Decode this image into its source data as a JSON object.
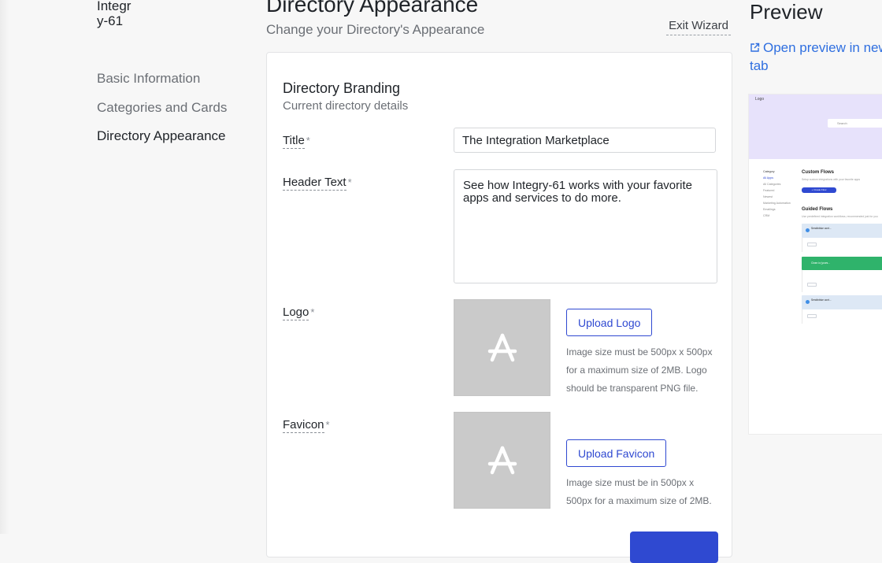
{
  "sidebar": {
    "workspace_name": "Integr\ny-61",
    "items": [
      {
        "label": "Basic Information",
        "active": false
      },
      {
        "label": "Categories and Cards",
        "active": false
      },
      {
        "label": "Directory Appearance",
        "active": true
      }
    ]
  },
  "header": {
    "title": "Directory Appearance",
    "subtitle": "Change your Directory's Appearance",
    "exit_label": "Exit Wizard"
  },
  "branding": {
    "section_title": "Directory Branding",
    "section_subtitle": "Current directory details",
    "required_marker": "*",
    "title_field": {
      "label": "Title",
      "value": "The Integration Marketplace"
    },
    "header_text_field": {
      "label": "Header Text",
      "value": "See how Integry-61 works with your favorite apps and services to do more."
    },
    "logo": {
      "label": "Logo",
      "button_label": "Upload Logo",
      "hint": "Image size must be 500px x 500px for a maximum size of 2MB. Logo should be transparent PNG file."
    },
    "favicon": {
      "label": "Favicon",
      "button_label": "Upload Favicon",
      "hint": "Image size must be in 500px x 500px for a maximum size of 2MB."
    }
  },
  "preview": {
    "title": "Preview",
    "open_link": "Open preview in new tab",
    "thumbnail": {
      "logo": "Logo",
      "search_placeholder": "Search",
      "categories_label": "Category",
      "categories": [
        "All Apps",
        "All Categories",
        "Featured",
        "Newest",
        "Marketing Automation",
        "Emailings",
        "CRM"
      ],
      "custom_flows_title": "Custom Flows",
      "custom_flows_desc": "Setup custom integrations with your favorite apps",
      "create_flow_button": "+ Create Flow",
      "guided_flows_title": "Guided Flows",
      "guided_flows_desc": "Use predefined integration workflows, recommended just for you",
      "flow_items": [
        "Sendinblue cont...",
        "Close.io (yours...",
        "Sendinblue cont..."
      ]
    }
  },
  "colors": {
    "accent": "#2f49d1",
    "link": "#2f6fe0",
    "placeholder_bg": "#cacaca"
  }
}
